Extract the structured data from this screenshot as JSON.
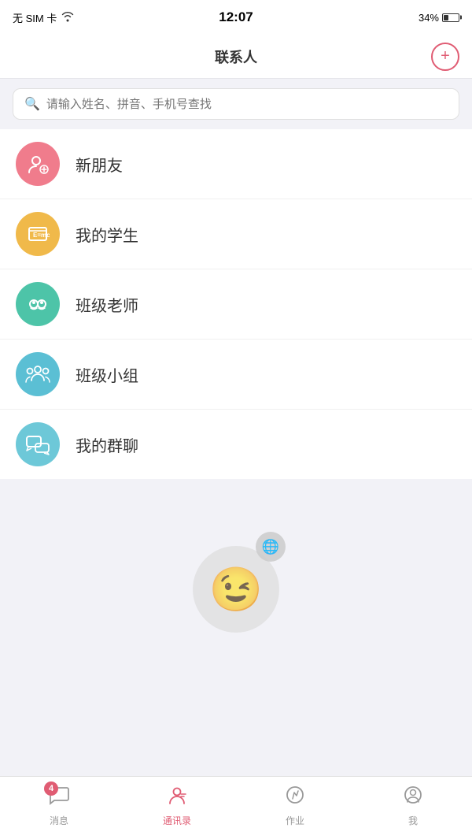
{
  "statusBar": {
    "carrier": "无 SIM 卡",
    "wifi": true,
    "time": "12:07",
    "battery": "34%"
  },
  "navBar": {
    "title": "联系人",
    "addButton": "+"
  },
  "search": {
    "placeholder": "请输入姓名、拼音、手机号查找"
  },
  "listItems": [
    {
      "id": 0,
      "label": "新朋友",
      "iconColor": "pink",
      "iconType": "add-friend"
    },
    {
      "id": 1,
      "label": "我的学生",
      "iconColor": "orange",
      "iconType": "students"
    },
    {
      "id": 2,
      "label": "班级老师",
      "iconColor": "teal",
      "iconType": "teacher"
    },
    {
      "id": 3,
      "label": "班级小组",
      "iconColor": "blue-teal",
      "iconType": "group"
    },
    {
      "id": 4,
      "label": "我的群聊",
      "iconColor": "light-blue",
      "iconType": "chat-group"
    }
  ],
  "tabs": [
    {
      "id": 0,
      "label": "消息",
      "icon": "message",
      "badge": "4",
      "active": false
    },
    {
      "id": 1,
      "label": "通讯录",
      "icon": "contacts",
      "badge": "",
      "active": true
    },
    {
      "id": 2,
      "label": "作业",
      "icon": "homework",
      "badge": "",
      "active": false
    },
    {
      "id": 3,
      "label": "我",
      "icon": "profile",
      "badge": "",
      "active": false
    }
  ]
}
